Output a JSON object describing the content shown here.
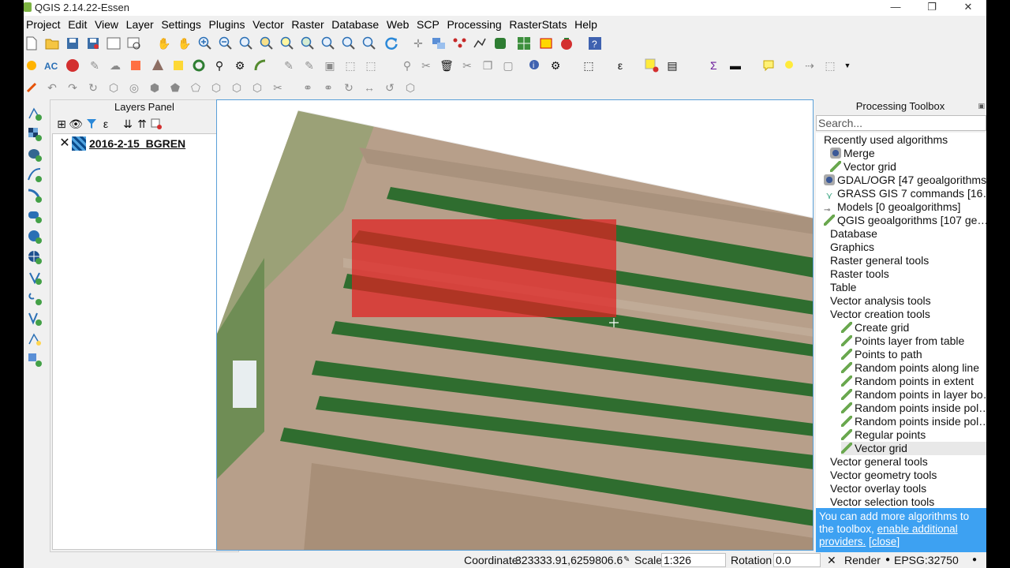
{
  "window": {
    "title": "QGIS 2.14.22-Essen",
    "controls": [
      "—",
      "❐",
      "✕"
    ]
  },
  "menu": [
    "Project",
    "Edit",
    "View",
    "Layer",
    "Settings",
    "Plugins",
    "Vector",
    "Raster",
    "Database",
    "Web",
    "SCP",
    "Processing",
    "RasterStats",
    "Help"
  ],
  "layers_panel": {
    "title": "Layers Panel",
    "layers": [
      {
        "name": "2016-2-15_BGREN",
        "checked": true
      }
    ]
  },
  "toolbox": {
    "title": "Processing Toolbox",
    "search_placeholder": "Search...",
    "items": [
      {
        "label": "Recently used algorithms",
        "level": 0,
        "icon": ""
      },
      {
        "label": "Merge",
        "level": 1,
        "icon": "gdal"
      },
      {
        "label": "Vector grid",
        "level": 1,
        "icon": "pencil"
      },
      {
        "label": "GDAL/OGR [47 geoalgorithms]",
        "level": 0,
        "icon": "gdal"
      },
      {
        "label": "GRASS GIS 7 commands [16…",
        "level": 0,
        "icon": "grass"
      },
      {
        "label": "Models [0 geoalgorithms]",
        "level": 0,
        "icon": "models"
      },
      {
        "label": "QGIS geoalgorithms [107 ge…",
        "level": 0,
        "icon": "pencil"
      },
      {
        "label": "Database",
        "level": 1,
        "icon": ""
      },
      {
        "label": "Graphics",
        "level": 1,
        "icon": ""
      },
      {
        "label": "Raster general tools",
        "level": 1,
        "icon": ""
      },
      {
        "label": "Raster tools",
        "level": 1,
        "icon": ""
      },
      {
        "label": "Table",
        "level": 1,
        "icon": ""
      },
      {
        "label": "Vector analysis tools",
        "level": 1,
        "icon": ""
      },
      {
        "label": "Vector creation tools",
        "level": 1,
        "icon": ""
      },
      {
        "label": "Create grid",
        "level": 2,
        "icon": "pencil"
      },
      {
        "label": "Points layer from table",
        "level": 2,
        "icon": "pencil"
      },
      {
        "label": "Points to path",
        "level": 2,
        "icon": "pencil"
      },
      {
        "label": "Random points along line",
        "level": 2,
        "icon": "pencil"
      },
      {
        "label": "Random points in extent",
        "level": 2,
        "icon": "pencil"
      },
      {
        "label": "Random points in layer bo…",
        "level": 2,
        "icon": "pencil"
      },
      {
        "label": "Random points inside pol…",
        "level": 2,
        "icon": "pencil"
      },
      {
        "label": "Random points inside pol…",
        "level": 2,
        "icon": "pencil"
      },
      {
        "label": "Regular points",
        "level": 2,
        "icon": "pencil"
      },
      {
        "label": "Vector grid",
        "level": 2,
        "icon": "pencil",
        "selected": true
      },
      {
        "label": "Vector general tools",
        "level": 1,
        "icon": ""
      },
      {
        "label": "Vector geometry tools",
        "level": 1,
        "icon": ""
      },
      {
        "label": "Vector overlay tools",
        "level": 1,
        "icon": ""
      },
      {
        "label": "Vector selection tools",
        "level": 1,
        "icon": ""
      }
    ],
    "info": {
      "text": "You can add more algorithms to the toolbox,",
      "link": "enable additional providers.",
      "close": "[close]"
    }
  },
  "status": {
    "coordinate_label": "Coordinate",
    "coordinate_value": "323333.91,6259806.62",
    "scale_label": "Scale",
    "scale_value": "1:326",
    "rotation_label": "Rotation",
    "rotation_value": "0.0",
    "render_label": "Render",
    "epsg": "EPSG:32750"
  },
  "colors": {
    "accent": "#3da1f2",
    "selection_overlay": "#e02020",
    "canvas_border": "#5aa0d8"
  },
  "icons": {
    "toolbar1": [
      "new-project-icon",
      "open-project-icon",
      "save-project-icon",
      "save-as-icon",
      "new-composer-icon",
      "composer-manager-icon",
      "pan-icon",
      "pan-to-selection-icon",
      "zoom-in-icon",
      "zoom-out-icon",
      "zoom-native-icon",
      "zoom-full-icon",
      "zoom-selection-icon",
      "zoom-layer-icon",
      "zoom-last-icon",
      "zoom-next-icon",
      "refresh-icon",
      "move-feature-icon",
      "identify-icon",
      "node-tool-icon",
      "python-icon",
      "scp-icon",
      "tomato-icon",
      "help-icon"
    ],
    "left": [
      "add-vector-icon",
      "add-raster-icon",
      "add-postgis-icon",
      "add-spatialite-icon",
      "add-mssql-icon",
      "add-oracle-icon",
      "add-wms-icon",
      "add-wcs-icon",
      "add-wfs-icon",
      "add-delimited-icon",
      "add-virtual-icon",
      "new-shapefile-icon",
      "new-temp-layer-icon"
    ]
  }
}
